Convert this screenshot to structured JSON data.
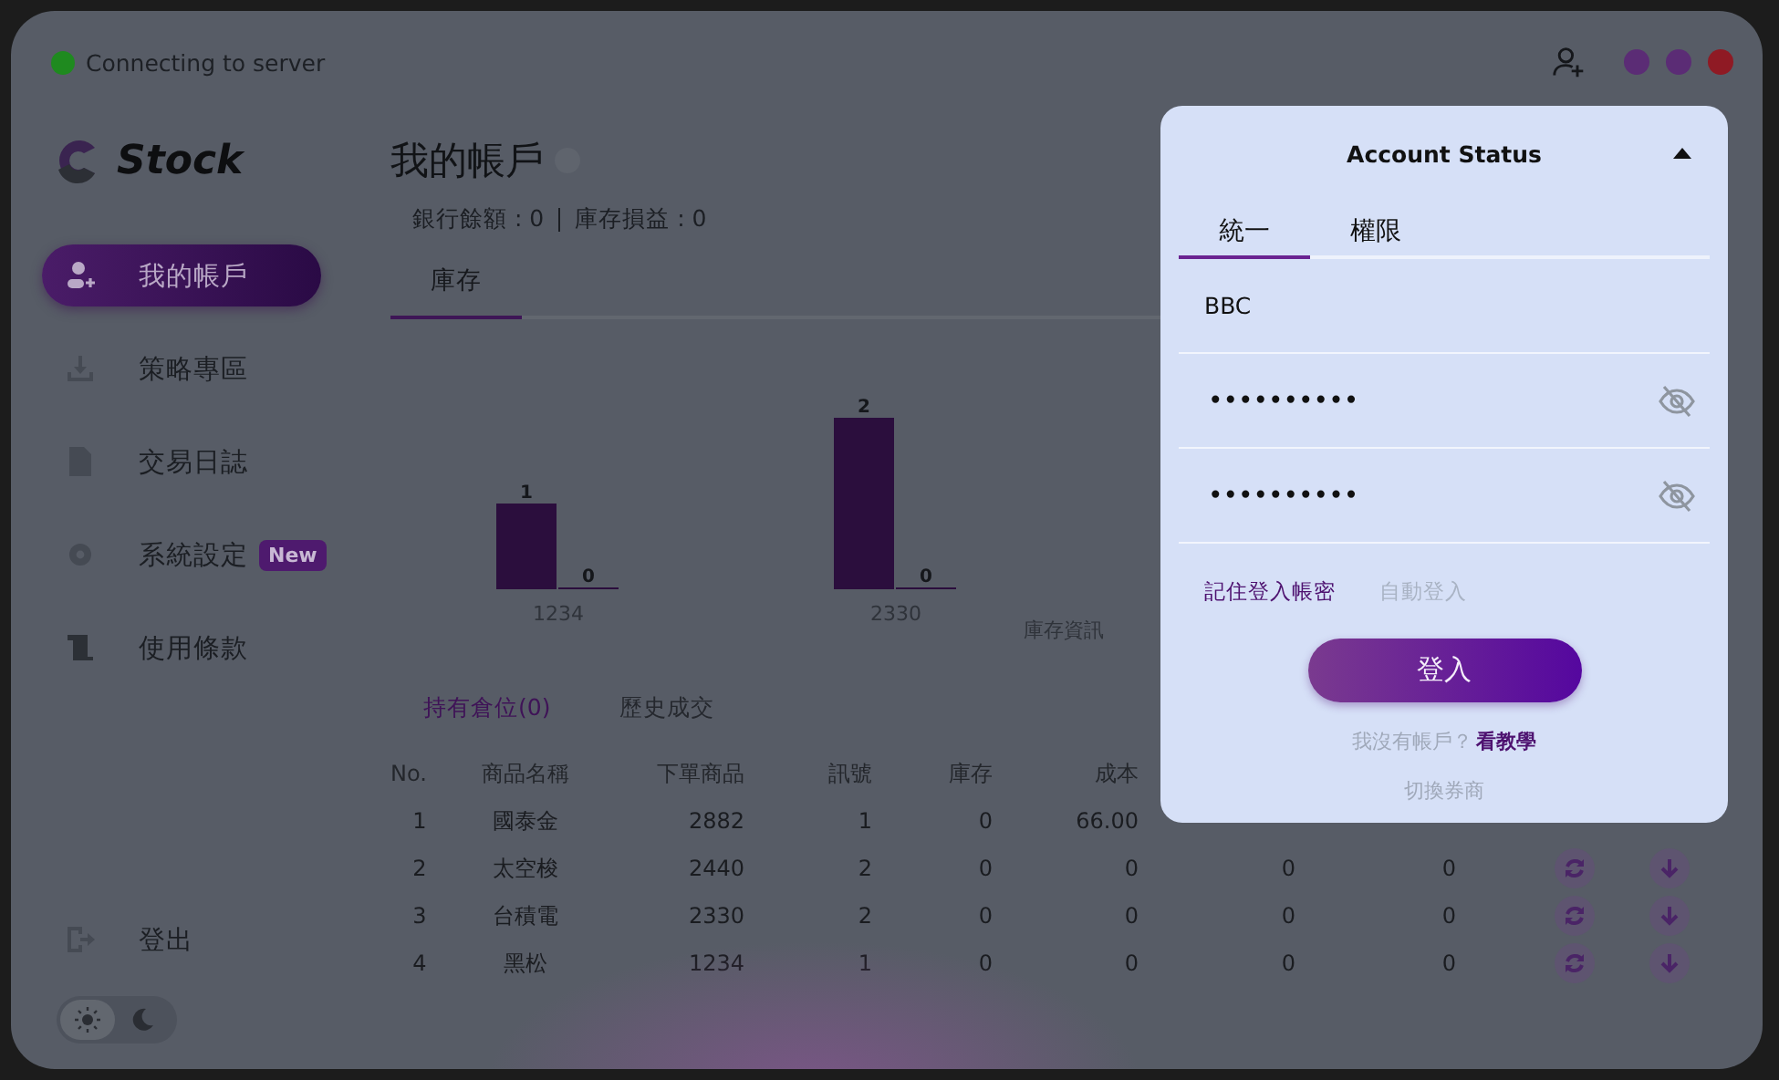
{
  "status": {
    "text": "Connecting to server"
  },
  "logo": {
    "text": "Stock"
  },
  "sidebar": {
    "items": [
      {
        "label": "我的帳戶",
        "selected": true
      },
      {
        "label": "策略專區",
        "selected": false
      },
      {
        "label": "交易日誌",
        "selected": false
      },
      {
        "label": "系統設定",
        "selected": false,
        "badge": "New"
      },
      {
        "label": "使用條款",
        "selected": false
      }
    ],
    "logout": "登出",
    "theme_options": [
      {
        "selected": true
      },
      {
        "selected": false
      }
    ]
  },
  "page": {
    "title": "我的帳戶",
    "summary": [
      "銀行餘額 : 0",
      "庫存損益 : 0"
    ],
    "tabs": [
      {
        "label": "庫存",
        "selected": true
      }
    ]
  },
  "chart": {
    "chart_data": {
      "type": "bar",
      "title": "庫存資訊",
      "categories": [
        "1234",
        "2330"
      ],
      "series": [
        {
          "color": "#2b0e3d",
          "values": [
            1,
            2
          ]
        },
        {
          "color": "#2b0e3d",
          "values": [
            0,
            0
          ]
        }
      ],
      "data_labels": true
    }
  },
  "positions": {
    "tabs": [
      {
        "label": "持有倉位(0)",
        "selected": true
      },
      {
        "label": "歷史成交",
        "selected": false
      }
    ],
    "columns": [
      "No.",
      "商品名稱",
      "下單商品",
      "訊號",
      "庫存",
      "成本"
    ],
    "rows": [
      {
        "cells": [
          "1",
          "國泰金",
          "2882",
          "1",
          "0",
          "66.00"
        ]
      },
      {
        "cells": [
          "2",
          "太空梭",
          "2440",
          "2",
          "0",
          "0",
          "0",
          "0"
        ]
      },
      {
        "cells": [
          "3",
          "台積電",
          "2330",
          "2",
          "0",
          "0",
          "0",
          "0"
        ]
      },
      {
        "cells": [
          "4",
          "黑松",
          "1234",
          "1",
          "0",
          "0",
          "0",
          "0"
        ]
      }
    ]
  },
  "login_panel": {
    "title": "Account Status",
    "expanded": true,
    "tabs": [
      {
        "label": "統一",
        "selected": true
      },
      {
        "label": "權限",
        "selected": false
      }
    ],
    "username": {
      "value": "BBC"
    },
    "passwords": [
      {
        "value": "••••••••••"
      },
      {
        "value": "••••••••••"
      }
    ],
    "options": [
      {
        "label": "記住登入帳密",
        "checked": true
      },
      {
        "label": "自動登入",
        "checked": false
      }
    ],
    "login_button": "登入",
    "signup_prompt": "我沒有帳戶？",
    "signup_link": "看教學",
    "switch_broker": "切換券商"
  }
}
